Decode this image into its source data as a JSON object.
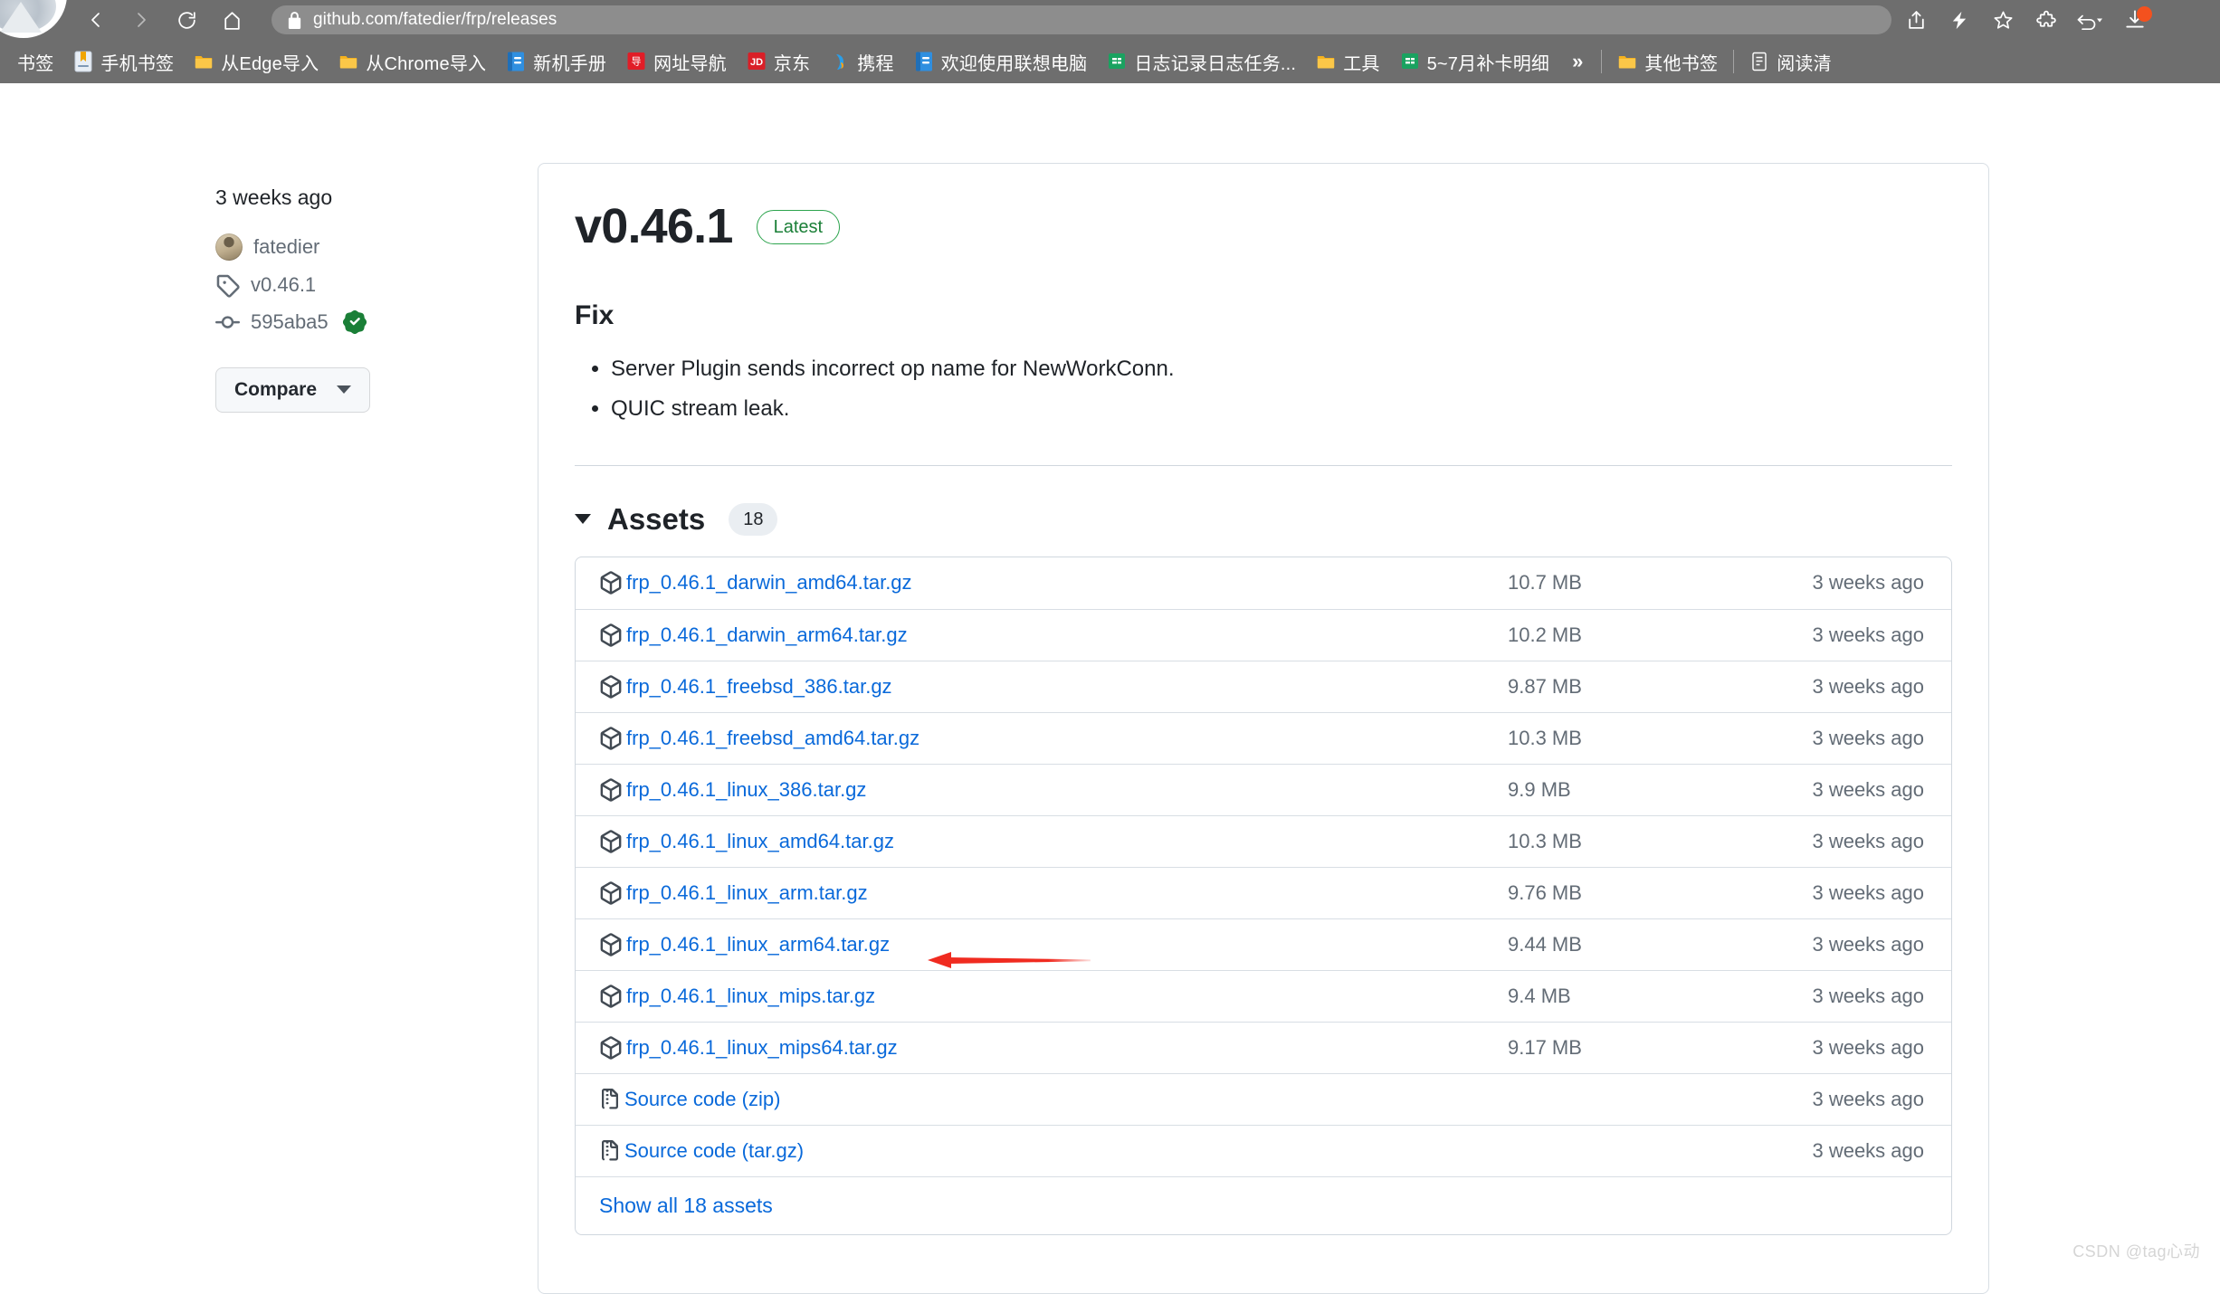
{
  "browser": {
    "url": "github.com/fatedier/frp/releases",
    "nav": {
      "back": "back-button",
      "forward": "forward-button",
      "reload": "reload-button",
      "home": "home-button"
    },
    "toolbar_icons": [
      "share-icon",
      "lightning-icon",
      "star-icon",
      "extensions-icon",
      "history-back-icon",
      "downloads-icon"
    ]
  },
  "bookmarks": {
    "items": [
      {
        "label": "书签",
        "icon": "none"
      },
      {
        "label": "手机书签",
        "icon": "bookmark-icon"
      },
      {
        "label": "从Edge导入",
        "icon": "folder-icon"
      },
      {
        "label": "从Chrome导入",
        "icon": "folder-icon"
      },
      {
        "label": "新机手册",
        "icon": "doc-icon"
      },
      {
        "label": "网址导航",
        "icon": "red-site-icon"
      },
      {
        "label": "京东",
        "icon": "jd-icon"
      },
      {
        "label": "携程",
        "icon": "ctrip-icon"
      },
      {
        "label": "欢迎使用联想电脑",
        "icon": "doc-icon"
      },
      {
        "label": "日志记录日志任务...",
        "icon": "sheet-icon"
      },
      {
        "label": "工具",
        "icon": "folder-icon"
      },
      {
        "label": "5~7月补卡明细",
        "icon": "sheet-icon"
      }
    ],
    "overflow": "»",
    "other_bookmarks": {
      "label": "其他书签",
      "icon": "folder-icon"
    },
    "reading_list": {
      "label": "阅读清",
      "icon": "reading-list-icon"
    }
  },
  "release": {
    "meta": {
      "published": "3 weeks ago",
      "author": "fatedier",
      "tag": "v0.46.1",
      "commit": "595aba5",
      "verified_label": "verified",
      "compare_label": "Compare"
    },
    "title": "v0.46.1",
    "latest_badge": "Latest",
    "body_heading": "Fix",
    "body_items": [
      "Server Plugin sends incorrect op name for NewWorkConn.",
      "QUIC stream leak."
    ]
  },
  "assets": {
    "heading": "Assets",
    "count": "18",
    "show_all": "Show all 18 assets",
    "rows": [
      {
        "name": "frp_0.46.1_darwin_amd64.tar.gz",
        "suffix": "",
        "icon": "package-icon",
        "size": "10.7 MB",
        "time": "3 weeks ago"
      },
      {
        "name": "frp_0.46.1_darwin_arm64.tar.gz",
        "suffix": "",
        "icon": "package-icon",
        "size": "10.2 MB",
        "time": "3 weeks ago"
      },
      {
        "name": "frp_0.46.1_freebsd_386.tar.gz",
        "suffix": "",
        "icon": "package-icon",
        "size": "9.87 MB",
        "time": "3 weeks ago"
      },
      {
        "name": "frp_0.46.1_freebsd_amd64.tar.gz",
        "suffix": "",
        "icon": "package-icon",
        "size": "10.3 MB",
        "time": "3 weeks ago"
      },
      {
        "name": "frp_0.46.1_linux_386.tar.gz",
        "suffix": "",
        "icon": "package-icon",
        "size": "9.9 MB",
        "time": "3 weeks ago"
      },
      {
        "name": "frp_0.46.1_linux_amd64.tar.gz",
        "suffix": "",
        "icon": "package-icon",
        "size": "10.3 MB",
        "time": "3 weeks ago"
      },
      {
        "name": "frp_0.46.1_linux_arm.tar.gz",
        "suffix": "",
        "icon": "package-icon",
        "size": "9.76 MB",
        "time": "3 weeks ago"
      },
      {
        "name": "frp_0.46.1_linux_arm64.tar.gz",
        "suffix": "",
        "icon": "package-icon",
        "size": "9.44 MB",
        "time": "3 weeks ago"
      },
      {
        "name": "frp_0.46.1_linux_mips.tar.gz",
        "suffix": "",
        "icon": "package-icon",
        "size": "9.4 MB",
        "time": "3 weeks ago"
      },
      {
        "name": "frp_0.46.1_linux_mips64.tar.gz",
        "suffix": "",
        "icon": "package-icon",
        "size": "9.17 MB",
        "time": "3 weeks ago"
      },
      {
        "name": "Source code",
        "suffix": " (zip)",
        "icon": "file-zip-icon",
        "size": "",
        "time": "3 weeks ago"
      },
      {
        "name": "Source code",
        "suffix": " (tar.gz)",
        "icon": "file-zip-icon",
        "size": "",
        "time": "3 weeks ago"
      }
    ]
  },
  "annotation": {
    "arrow_color": "#f02b20",
    "target_row_index": 5
  },
  "watermark": "CSDN @tag心动",
  "colors": {
    "link": "#0969da",
    "muted": "#636c76",
    "text": "#1f2328",
    "border": "#d0d7de",
    "chrome": "#6e6e6e",
    "green": "#1a7f37"
  }
}
